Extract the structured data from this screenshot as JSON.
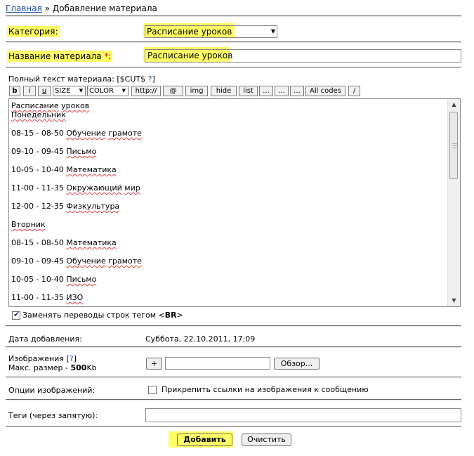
{
  "breadcrumb": {
    "home": "Главная",
    "separator": "»",
    "current": "Добавление материала"
  },
  "category": {
    "label": "Категория:",
    "value": "Расписание уроков"
  },
  "title_field": {
    "label": "Название материала",
    "required": "*",
    "colon": ":",
    "value": "Расписание уроков"
  },
  "fulltext": {
    "label": "Полный текст материала: [$CUT$",
    "help": "?",
    "close": "]"
  },
  "toolbar": {
    "bold": "b",
    "italic": "i",
    "underline": "u",
    "size": "SIZE",
    "color": "COLOR",
    "url": "http://",
    "email": "@",
    "img": "img",
    "hide": "hide",
    "list": "list",
    "dots1": "...",
    "dots2": "...",
    "dots3": "...",
    "all_codes": "All codes",
    "slash": "/"
  },
  "content_lines": [
    [
      {
        "t": "Расписание",
        "s": 1
      },
      {
        "t": " "
      },
      {
        "t": "уроков",
        "s": 1
      }
    ],
    [
      {
        "t": "Понедельник",
        "s": 1
      }
    ],
    [],
    [
      {
        "t": "08-15 - 08-50 "
      },
      {
        "t": "Обучение",
        "s": 1
      },
      {
        "t": " "
      },
      {
        "t": "грамоте",
        "s": 1
      }
    ],
    [],
    [
      {
        "t": "09-10 - 09-45 "
      },
      {
        "t": "Письмо",
        "s": 1
      }
    ],
    [],
    [
      {
        "t": "10-05 - 10-40 "
      },
      {
        "t": "Математика",
        "s": 1
      }
    ],
    [],
    [
      {
        "t": "11-00 - 11-35 "
      },
      {
        "t": "Окружающий",
        "s": 1
      },
      {
        "t": " "
      },
      {
        "t": "мир",
        "s": 1
      }
    ],
    [],
    [
      {
        "t": "12-00 - 12-35 "
      },
      {
        "t": "Физкультура",
        "s": 1
      }
    ],
    [],
    [
      {
        "t": "Вторник",
        "s": 1
      }
    ],
    [],
    [
      {
        "t": "08-15 - 08-50 "
      },
      {
        "t": "Математика",
        "s": 1
      }
    ],
    [],
    [
      {
        "t": "09-10 - 09-45 "
      },
      {
        "t": "Обучение",
        "s": 1
      },
      {
        "t": " "
      },
      {
        "t": "грамоте",
        "s": 1
      }
    ],
    [],
    [
      {
        "t": "10-05 - 10-40 "
      },
      {
        "t": "Письмо",
        "s": 1
      }
    ],
    [],
    [
      {
        "t": "11-00 - 11-35 "
      },
      {
        "t": "ИЗО",
        "s": 1
      }
    ]
  ],
  "br_option": {
    "label": "Заменять переводы строк тегом <",
    "tag": "BR",
    "close": ">",
    "checked": true
  },
  "date": {
    "label": "Дата добавления:",
    "value": "Суббота, 22.10.2011, 17:09"
  },
  "images": {
    "label": "Изображения [",
    "help": "?",
    "close": "]",
    "size_label": "Макс. размер - ",
    "size_value": "500",
    "size_unit": "Kb",
    "plus": "+",
    "browse": "Обзор..."
  },
  "image_options": {
    "label": "Опции изображений:",
    "checkbox_label": "Прикрепить ссылки на изображения к сообщению",
    "checked": false
  },
  "tags": {
    "label": "Теги (через запятую):",
    "value": ""
  },
  "actions": {
    "submit": "Добавить",
    "reset": "Очистить"
  },
  "colors": {
    "highlight": "#ffff66",
    "link": "#1c4c9c",
    "spell": "#e04040"
  }
}
